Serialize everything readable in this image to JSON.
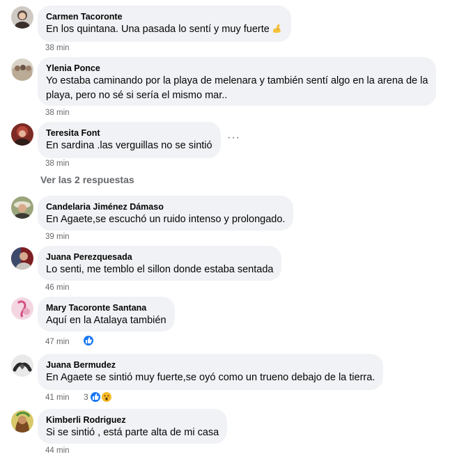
{
  "comments": [
    {
      "author": "Carmen Tacoronte",
      "lines": [
        "En los quintana. Una pasada lo sentí y muy fuerte"
      ],
      "time": "38 min",
      "emoji": "flexed-biceps-icon"
    },
    {
      "author": "Ylenia Ponce",
      "lines": [
        "Yo estaba caminando por la playa de melenara y también sentí algo en la arena de la",
        "playa, pero no sé si sería el mismo mar.."
      ],
      "time": "38 min"
    },
    {
      "author": "Teresita Font",
      "lines": [
        "En sardina .las verguillas no se sintió"
      ],
      "time": "38 min",
      "more": "···"
    },
    {
      "author": "Candelaria Jiménez Dámaso",
      "lines": [
        "En Agaete,se escuchó un ruido intenso y prolongado."
      ],
      "time": "39 min"
    },
    {
      "author": "Juana Perezquesada",
      "lines": [
        "Lo senti, me temblo el sillon donde estaba sentada"
      ],
      "time": "46 min"
    },
    {
      "author": "Mary Tacoronte Santana",
      "lines": [
        "Aquí en la Atalaya también"
      ],
      "time": "47 min",
      "reactions": [
        "like-icon"
      ]
    },
    {
      "author": "Juana Bermudez",
      "lines": [
        "En Agaete se sintió muy fuerte,se oyó como un trueno debajo de la tierra."
      ],
      "time": "41 min",
      "reaction_count": "3",
      "reactions": [
        "like-icon",
        "wow-icon"
      ]
    },
    {
      "author": "Kimberli Rodriguez",
      "lines": [
        "Si se sintió , está parte alta de mi casa"
      ],
      "time": "44 min"
    }
  ],
  "view_replies": "Ver las 2 respuestas",
  "colors": {
    "bubble": "#f0f2f5",
    "meta": "#65676b",
    "like": "#1877f2",
    "wow": "#f7b928"
  }
}
